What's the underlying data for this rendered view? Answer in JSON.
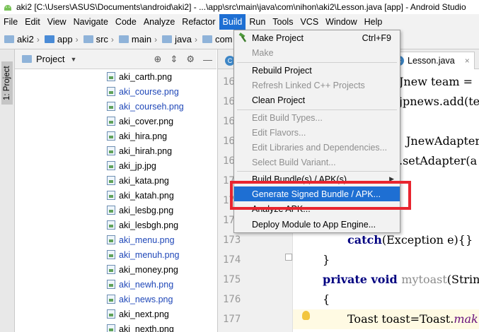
{
  "window": {
    "title": "aki2 [C:\\Users\\ASUS\\Documents\\android\\aki2] - ...\\app\\src\\main\\java\\com\\nihon\\aki2\\Lesson.java [app] - Android Studio"
  },
  "menubar": {
    "items": [
      "File",
      "Edit",
      "View",
      "Navigate",
      "Code",
      "Analyze",
      "Refactor",
      "Build",
      "Run",
      "Tools",
      "VCS",
      "Window",
      "Help"
    ],
    "active": "Build"
  },
  "breadcrumb": [
    "aki2",
    "app",
    "src",
    "main",
    "java",
    "com"
  ],
  "side_tool": {
    "label": "1: Project"
  },
  "project_panel": {
    "label": "Project",
    "files": [
      {
        "name": "aki_carth.png",
        "modified": false
      },
      {
        "name": "aki_course.png",
        "modified": true
      },
      {
        "name": "aki_courseh.png",
        "modified": true
      },
      {
        "name": "aki_cover.png",
        "modified": false
      },
      {
        "name": "aki_hira.png",
        "modified": false
      },
      {
        "name": "aki_hirah.png",
        "modified": false
      },
      {
        "name": "aki_jp.jpg",
        "modified": false
      },
      {
        "name": "aki_kata.png",
        "modified": false
      },
      {
        "name": "aki_katah.png",
        "modified": false
      },
      {
        "name": "aki_lesbg.png",
        "modified": false
      },
      {
        "name": "aki_lesbgh.png",
        "modified": false
      },
      {
        "name": "aki_menu.png",
        "modified": true
      },
      {
        "name": "aki_menuh.png",
        "modified": true
      },
      {
        "name": "aki_money.png",
        "modified": false
      },
      {
        "name": "aki_newh.png",
        "modified": true
      },
      {
        "name": "aki_news.png",
        "modified": true
      },
      {
        "name": "aki_next.png",
        "modified": false
      },
      {
        "name": "aki_nexth.png",
        "modified": false
      }
    ]
  },
  "editor": {
    "tabs": [
      {
        "label": "",
        "icon": "C",
        "active": false
      },
      {
        "label": "Lesson.java",
        "icon": "C",
        "active": true
      }
    ],
    "line_numbers": [
      "16",
      "16",
      "16",
      "16",
      "16",
      "17",
      "17",
      "17",
      "173",
      "174",
      "175",
      "176",
      "177"
    ],
    "code": {
      "l1": "Jnew  team =",
      "l2": "jpnews.add(te",
      "l4": "JnewAdapter",
      "l5": ".setAdapter(a",
      "l173_kw": "catch",
      "l173_rest": "(Exception e){}",
      "l174": "}",
      "l175_kw": "private void ",
      "l175_fn": "mytoast",
      "l175_rest": "(Strin",
      "l176": "{",
      "l177_a": "Toast toast=Toast.",
      "l177_m": "mak"
    }
  },
  "build_menu": {
    "make_project": "Make Project",
    "make_project_shortcut": "Ctrl+F9",
    "make": "Make",
    "rebuild_project": "Rebuild Project",
    "refresh_linked": "Refresh Linked C++ Projects",
    "clean_project": "Clean Project",
    "edit_build_types": "Edit Build Types...",
    "edit_flavors": "Edit Flavors...",
    "edit_libraries": "Edit Libraries and Dependencies...",
    "select_build_variant": "Select Build Variant...",
    "build_bundles": "Build Bundle(s) / APK(s)",
    "generate_signed": "Generate Signed Bundle / APK...",
    "analyze_apk": "Analyze APK...",
    "deploy_module": "Deploy Module to App Engine..."
  },
  "colors": {
    "highlight": "#1e6fd3",
    "annotation_box": "#e8252f",
    "modified_file": "#1f47b8"
  }
}
